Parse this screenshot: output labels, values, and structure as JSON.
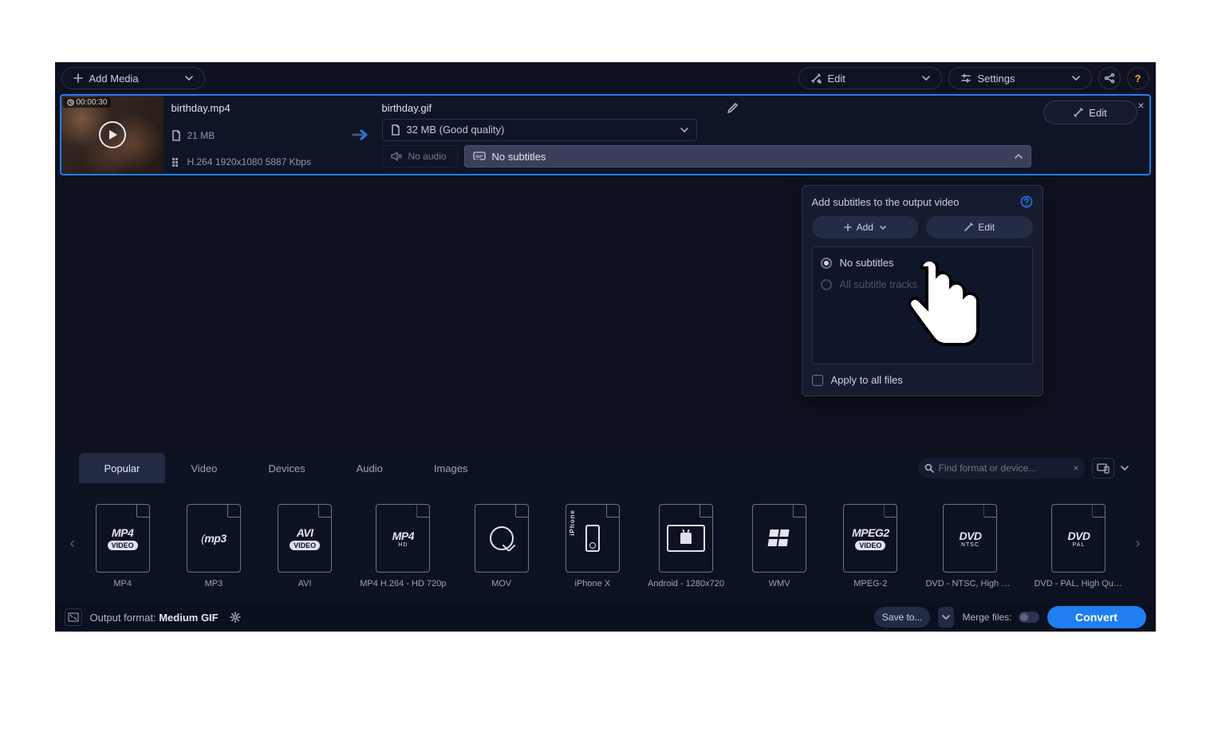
{
  "topbar": {
    "add_media": "Add Media",
    "edit": "Edit",
    "settings": "Settings"
  },
  "file": {
    "duration": "00:00:30",
    "src_name": "birthday.mp4",
    "src_size": "21 MB",
    "src_codec": "H.264 1920x1080 5887 Kbps",
    "out_name": "birthday.gif",
    "out_size": "32 MB (Good quality)",
    "audio": "No audio",
    "subtitles": "No subtitles",
    "edit_btn": "Edit",
    "close": "×"
  },
  "popover": {
    "title": "Add subtitles to the output video",
    "add": "Add",
    "edit": "Edit",
    "opt_none": "No subtitles",
    "opt_all": "All subtitle tracks",
    "apply_all": "Apply to all files"
  },
  "tabs": {
    "popular": "Popular",
    "video": "Video",
    "devices": "Devices",
    "audio": "Audio",
    "images": "Images"
  },
  "search": {
    "placeholder": "Find format or device...",
    "close": "×"
  },
  "formats": [
    {
      "id": "mp4",
      "big": "MP4",
      "sub": "VIDEO",
      "label": "MP4",
      "kind": "txt"
    },
    {
      "id": "mp3",
      "big": "mp3",
      "label": "MP3",
      "kind": "mp3"
    },
    {
      "id": "avi",
      "big": "AVI",
      "sub": "VIDEO",
      "label": "AVI",
      "kind": "txt"
    },
    {
      "id": "mp4hd",
      "big": "MP4",
      "sub": "HD",
      "label": "MP4 H.264 - HD 720p",
      "kind": "txt"
    },
    {
      "id": "mov",
      "label": "MOV",
      "kind": "qt"
    },
    {
      "id": "iphx",
      "label": "iPhone X",
      "kind": "phone",
      "ph": "iPhone"
    },
    {
      "id": "android",
      "label": "Android - 1280x720",
      "kind": "tablet"
    },
    {
      "id": "wmv",
      "label": "WMV",
      "kind": "win"
    },
    {
      "id": "mpeg2",
      "big": "MPEG2",
      "sub": "VIDEO",
      "label": "MPEG-2",
      "kind": "txt"
    },
    {
      "id": "dvdntsc",
      "big": "DVD",
      "sub": "NTSC",
      "label": "DVD - NTSC, High Qu...",
      "kind": "dvd"
    },
    {
      "id": "dvdpal",
      "big": "DVD",
      "sub": "PAL",
      "label": "DVD - PAL, High Qual...",
      "kind": "dvd"
    }
  ],
  "footer": {
    "out_label": "Output format:",
    "out_value": "Medium GIF",
    "save_to": "Save to...",
    "merge": "Merge files:",
    "convert": "Convert"
  }
}
